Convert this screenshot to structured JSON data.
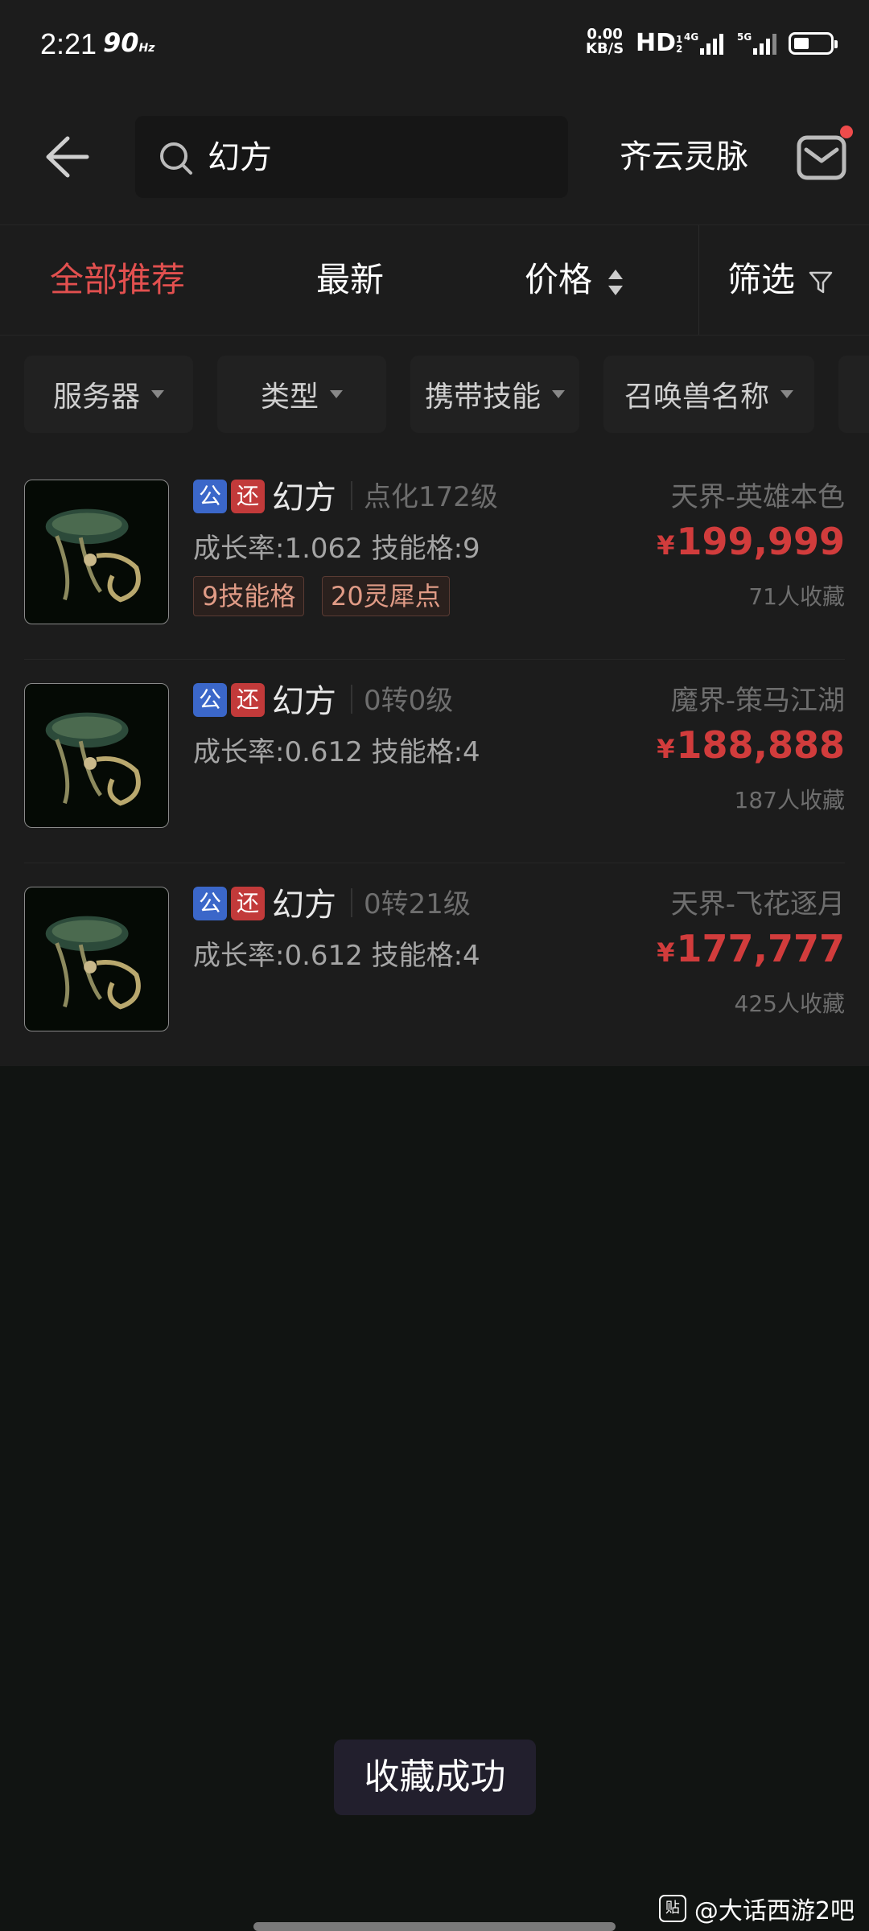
{
  "status_bar": {
    "time": "2:21",
    "refresh_rate": "90",
    "refresh_unit": "Hz",
    "net_speed": "0.00",
    "net_unit": "KB/S",
    "hd": "HD",
    "hd_sub": "1 2",
    "sig1_label": "4G",
    "sig2_label": "5G"
  },
  "header": {
    "search_value": "幻方",
    "server_name": "齐云灵脉"
  },
  "sort_tabs": {
    "all": "全部推荐",
    "newest": "最新",
    "price": "价格",
    "filter": "筛选"
  },
  "filters": [
    "服务器",
    "类型",
    "携带技能",
    "召唤兽名称"
  ],
  "badges": {
    "public": "公",
    "return": "还"
  },
  "listings": [
    {
      "name": "幻方",
      "level": "点化172级",
      "stats": "成长率:1.062 技能格:9",
      "tags": [
        "9技能格",
        "20灵犀点"
      ],
      "server": "天界-英雄本色",
      "currency": "¥",
      "price": "199,999",
      "favorites": "71人收藏"
    },
    {
      "name": "幻方",
      "level": "0转0级",
      "stats": "成长率:0.612 技能格:4",
      "tags": [],
      "server": "魔界-策马江湖",
      "currency": "¥",
      "price": "188,888",
      "favorites": "187人收藏"
    },
    {
      "name": "幻方",
      "level": "0转21级",
      "stats": "成长率:0.612 技能格:4",
      "tags": [],
      "server": "天界-飞花逐月",
      "currency": "¥",
      "price": "177,777",
      "favorites": "425人收藏"
    }
  ],
  "toast": "收藏成功",
  "watermark": {
    "logo": "贴",
    "text": "@大话西游2吧"
  },
  "colors": {
    "accent_red": "#e2504f",
    "price_red": "#d13c3c",
    "badge_blue": "#3b67c9",
    "badge_red": "#c23a3a"
  }
}
